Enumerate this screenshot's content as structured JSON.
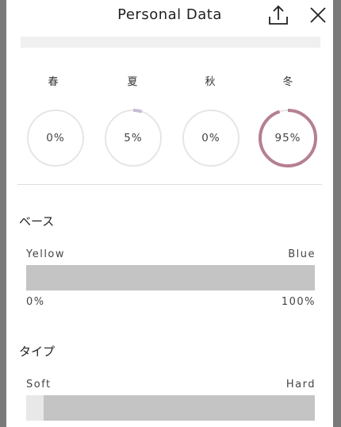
{
  "header": {
    "title": "Personal Data"
  },
  "seasons": [
    {
      "label": "春",
      "percent_text": "0%",
      "value": 0,
      "color": "#d8d8d8"
    },
    {
      "label": "夏",
      "percent_text": "5%",
      "value": 5,
      "color": "#c8bcd6"
    },
    {
      "label": "秋",
      "percent_text": "0%",
      "value": 0,
      "color": "#d8d8d8"
    },
    {
      "label": "冬",
      "percent_text": "95%",
      "value": 95,
      "color": "#b57f92"
    }
  ],
  "base": {
    "title": "ベース",
    "left_label": "Yellow",
    "right_label": "Blue",
    "min_label": "0%",
    "max_label": "100%",
    "value": 1.0
  },
  "type": {
    "title": "タイプ",
    "left_label": "Soft",
    "right_label": "Hard",
    "value": 0.94
  },
  "colors": {
    "ring_track": "#e6e6e6",
    "bar_track": "#e8e8e8",
    "bar_fill": "#c4c4c4"
  },
  "icons": {
    "share": "share-icon",
    "close": "close-icon"
  }
}
